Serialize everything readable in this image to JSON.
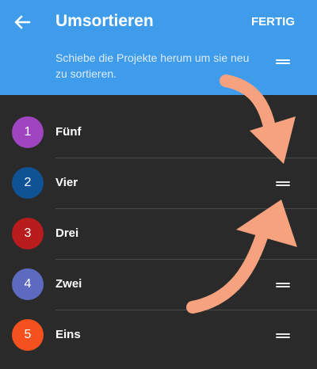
{
  "header": {
    "title": "Umsortieren",
    "done_label": "FERTIG",
    "hint": "Schiebe die Projekte herum um sie neu zu sortieren.",
    "back_icon": "arrow-left-icon",
    "handle_icon": "drag-handle-icon"
  },
  "items": [
    {
      "number": "1",
      "label": "Fünf",
      "color": "#a044c0",
      "handle_visible": false
    },
    {
      "number": "2",
      "label": "Vier",
      "color": "#0f5394",
      "handle_visible": true
    },
    {
      "number": "3",
      "label": "Drei",
      "color": "#b81c1c",
      "handle_visible": false
    },
    {
      "number": "4",
      "label": "Zwei",
      "color": "#5c6bc0",
      "handle_visible": true
    },
    {
      "number": "5",
      "label": "Eins",
      "color": "#f4511e",
      "handle_visible": true
    }
  ],
  "colors": {
    "header_bg": "#3f9ceb",
    "list_bg": "#2a2a2a",
    "annotation_arrow": "#f6a27f"
  }
}
